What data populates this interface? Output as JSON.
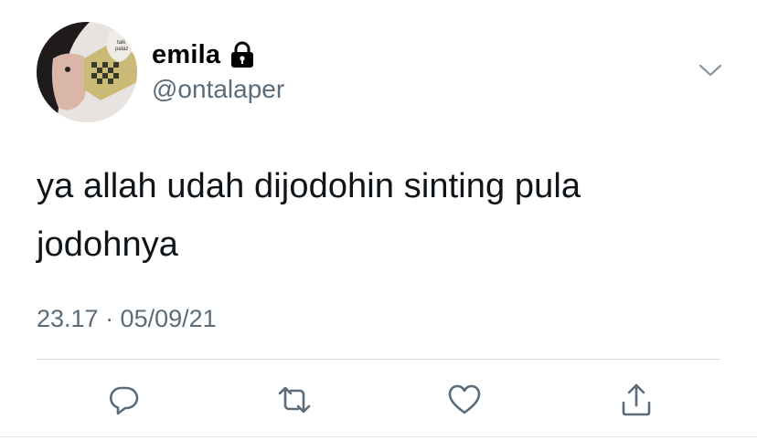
{
  "user": {
    "display_name": "emila",
    "handle": "@ontalaper",
    "avatar_cup_text": "talk\npalaz"
  },
  "tweet": {
    "text_line_1": "ya allah udah dijodohin sinting pula",
    "text_line_2": "jodohnya",
    "timestamp": "23.17 · 05/09/21"
  },
  "icons": {
    "lock": "lock-icon",
    "menu": "chevron-down-icon",
    "reply": "reply-icon",
    "retweet": "retweet-icon",
    "like": "heart-icon",
    "share": "share-icon"
  },
  "colors": {
    "text": "#0f1419",
    "secondary": "#5b6b78",
    "icon": "#5b6b78",
    "divider": "#d8dde1"
  }
}
